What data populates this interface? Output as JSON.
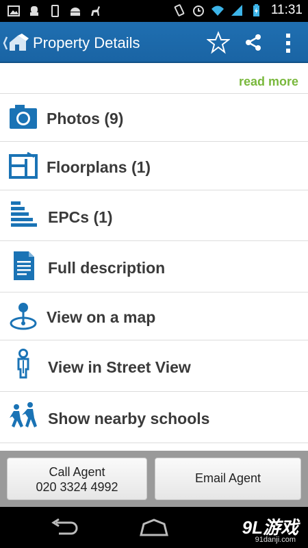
{
  "status_bar": {
    "time": "11:31",
    "left_icons": [
      "gallery-icon",
      "android-icon",
      "phone-icon",
      "android-robot-icon",
      "deer-icon"
    ],
    "right_icons": [
      "vibrate-icon",
      "alarm-icon",
      "wifi-icon",
      "signal-icon",
      "battery-charging-icon"
    ]
  },
  "action_bar": {
    "title": "Property Details",
    "icons": [
      "app-logo-icon",
      "star-icon",
      "share-icon",
      "overflow-menu-icon"
    ]
  },
  "content": {
    "read_more": "read more",
    "rows": [
      {
        "label": "Photos (9)",
        "icon": "camera-icon"
      },
      {
        "label": "Floorplans (1)",
        "icon": "floorplan-icon"
      },
      {
        "label": "EPCs (1)",
        "icon": "epc-bars-icon"
      },
      {
        "label": "Full description",
        "icon": "document-icon"
      },
      {
        "label": "View on a map",
        "icon": "map-pin-icon"
      },
      {
        "label": "View in Street View",
        "icon": "street-view-person-icon"
      },
      {
        "label": "Show nearby schools",
        "icon": "schoolchildren-icon"
      }
    ]
  },
  "bottom_buttons": {
    "call_label": "Call Agent",
    "call_number": "020 3324 4992",
    "email_label": "Email Agent"
  },
  "nav_bar": {
    "icons": [
      "back-icon",
      "home-icon"
    ],
    "watermark": "9L游戏",
    "watermark_sub": "91danji.com"
  },
  "colors": {
    "action_bar": "#1f6fb1",
    "icon_blue": "#1a73b5",
    "read_more_green": "#79b83c"
  }
}
